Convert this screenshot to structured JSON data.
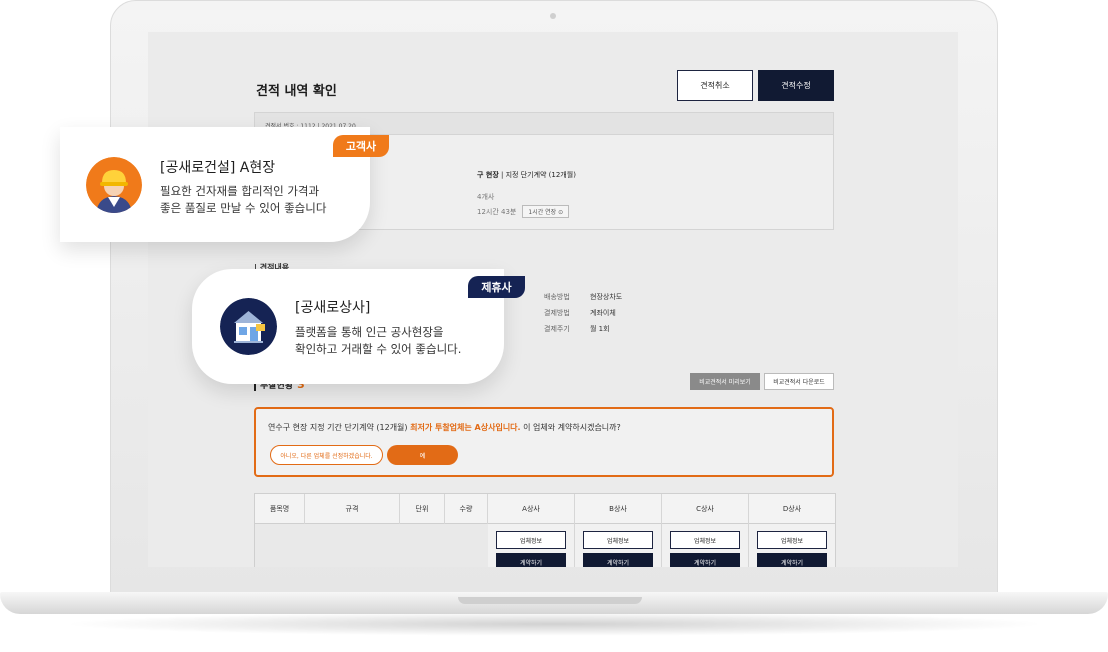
{
  "quote_page": {
    "title": "견적 내역 확인",
    "cancel_label": "견적취소",
    "edit_label": "견적수정",
    "quote_header": "견적서 번호 : 1112   |   2021.07.20",
    "site_name": "구 현장",
    "contract_type": "|   지정 단기계약 (12개월)",
    "count_text": "4개사",
    "time_text": "12시간 43분",
    "time_pill": "1시간 연장 ⊙",
    "section_label": "| 견적내용",
    "info": [
      {
        "key": "배송방법",
        "value": "현장상차도"
      },
      {
        "key": "결제방법",
        "value": "계좌이체"
      },
      {
        "key": "결제주기",
        "value": "월 1회"
      }
    ],
    "bids_title": "투찰현황",
    "bids_count": "3",
    "preview_label": "비교견적서 미리보기",
    "download_label": "비교견적서 다운로드",
    "notice": {
      "text_before": "연수구 현장 지정 기간 단기계약 (12개월) ",
      "text_highlight": "최저가 투찰업체는 A상사입니다.",
      "text_after": " 이 업체와 계약하시겠습니까?",
      "no_label": "아니오, 다른 업체를 선정하겠습니다.",
      "yes_label": "예"
    },
    "table": {
      "headers": [
        "품목명",
        "규격",
        "단위",
        "수량"
      ],
      "vendors": [
        "A상사",
        "B상사",
        "C상사",
        "D상사"
      ],
      "info_label": "업체정보",
      "contract_label": "계약하기"
    }
  },
  "customer_card": {
    "badge": "고객사",
    "title": "[공새로건설] A현장",
    "line1": "필요한 건자재를 합리적인 가격과",
    "line2": "좋은 품질로 만날 수 있어 좋습니다",
    "avatar_icon": "worker-avatar-icon"
  },
  "partner_card": {
    "badge": "제휴사",
    "title": "[공새로상사]",
    "line1": "플랫폼을 통해 인근 공사현장을",
    "line2": "확인하고 거래할 수 있어 좋습니다.",
    "avatar_icon": "store-avatar-icon"
  },
  "colors": {
    "accent_orange": "#e26b16",
    "navy": "#111a33",
    "badge_orange": "#f07a1a",
    "badge_navy": "#152354"
  }
}
